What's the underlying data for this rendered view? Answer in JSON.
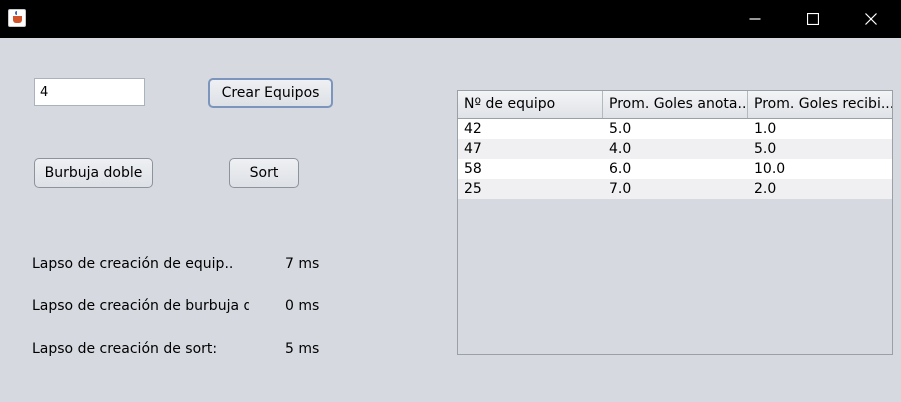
{
  "window": {
    "icon": "java-cup-icon",
    "controls": [
      "minimize-icon",
      "maximize-icon",
      "close-icon"
    ]
  },
  "input": {
    "value": "4"
  },
  "buttons": {
    "crear": "Crear Equipos",
    "burbuja": "Burbuja doble",
    "sort": "Sort"
  },
  "labels": {
    "lapso_creacion": "Lapso de creación de equip..",
    "lapso_burbuja": "Lapso de creación de burbuja dob",
    "lapso_sort": "Lapso de creación de sort:",
    "tiempo_creacion": "7 ms",
    "tiempo_burbuja": "0 ms",
    "tiempo_sort": "5 ms"
  },
  "table": {
    "headers": [
      "Nº de equipo",
      "Prom. Goles anota...",
      "Prom. Goles recibi..."
    ],
    "rows": [
      [
        "42",
        "5.0",
        "1.0"
      ],
      [
        "47",
        "4.0",
        "5.0"
      ],
      [
        "58",
        "6.0",
        "10.0"
      ],
      [
        "25",
        "7.0",
        "2.0"
      ]
    ]
  }
}
